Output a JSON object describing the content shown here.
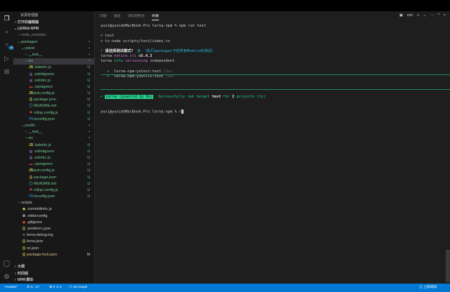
{
  "sidebar": {
    "header": "资源管理器",
    "open_editors": "打开的编辑器",
    "project": "LERNA-NPM",
    "items": [
      {
        "label": "node_modules",
        "indent": 1,
        "chev": "›",
        "icon": "",
        "status": "",
        "color": "#8c8c8c"
      },
      {
        "label": "packages",
        "indent": 1,
        "chev": "⌄",
        "icon": "",
        "status": "•",
        "color": "#73c991"
      },
      {
        "label": "yxtest",
        "indent": 2,
        "chev": "⌄",
        "icon": "",
        "status": "•",
        "color": "#73c991"
      },
      {
        "label": "__test__",
        "indent": 3,
        "chev": "›",
        "icon": "",
        "status": "•",
        "color": "#73c991"
      },
      {
        "label": "src",
        "indent": 3,
        "chev": "›",
        "icon": "",
        "status": "•",
        "color": "#73c991",
        "selected": true
      },
      {
        "label": ".babelrc.js",
        "indent": 3,
        "chev": "",
        "icon": "JS",
        "icolor": "#e8d44d",
        "status": "U",
        "color": "#73c991"
      },
      {
        "label": ".eslintignore",
        "indent": 3,
        "chev": "",
        "icon": "◎",
        "icolor": "#a074c4",
        "status": "U",
        "color": "#73c991"
      },
      {
        "label": ".eslintrc.js",
        "indent": 3,
        "chev": "",
        "icon": "◎",
        "icolor": "#a074c4",
        "status": "U",
        "color": "#73c991"
      },
      {
        "label": ".npmignore",
        "indent": 3,
        "chev": "",
        "icon": "▬",
        "icolor": "#cb3837",
        "status": "U",
        "color": "#73c991"
      },
      {
        "label": "jest.config.js",
        "indent": 3,
        "chev": "",
        "icon": "JS",
        "icolor": "#e8d44d",
        "status": "U",
        "color": "#73c991"
      },
      {
        "label": "package.json",
        "indent": 3,
        "chev": "",
        "icon": "{}",
        "icolor": "#e8d44d",
        "status": "U",
        "color": "#73c991"
      },
      {
        "label": "README.md",
        "indent": 3,
        "chev": "",
        "icon": "ⓘ",
        "icolor": "#519aba",
        "status": "U",
        "color": "#73c991"
      },
      {
        "label": "rollup.config.js",
        "indent": 3,
        "chev": "",
        "icon": "⚑",
        "icolor": "#ec4a3f",
        "status": "U",
        "color": "#73c991"
      },
      {
        "label": "tsconfig.json",
        "indent": 3,
        "chev": "",
        "icon": "TS",
        "icolor": "#3178c6",
        "status": "U",
        "color": "#73c991"
      },
      {
        "label": "yxutils",
        "indent": 2,
        "chev": "⌄",
        "icon": "",
        "status": "•",
        "color": "#73c991"
      },
      {
        "label": "__test__",
        "indent": 3,
        "chev": "›",
        "icon": "",
        "status": "•",
        "color": "#73c991"
      },
      {
        "label": "src",
        "indent": 3,
        "chev": "›",
        "icon": "",
        "status": "•",
        "color": "#73c991"
      },
      {
        "label": ".babelrc.js",
        "indent": 3,
        "chev": "",
        "icon": "JS",
        "icolor": "#e8d44d",
        "status": "U",
        "color": "#73c991"
      },
      {
        "label": ".eslintignore",
        "indent": 3,
        "chev": "",
        "icon": "◎",
        "icolor": "#a074c4",
        "status": "U",
        "color": "#73c991"
      },
      {
        "label": ".eslintrc.js",
        "indent": 3,
        "chev": "",
        "icon": "◎",
        "icolor": "#a074c4",
        "status": "U",
        "color": "#73c991"
      },
      {
        "label": ".npmignore",
        "indent": 3,
        "chev": "",
        "icon": "▬",
        "icolor": "#cb3837",
        "status": "U",
        "color": "#73c991"
      },
      {
        "label": "jest.config.js",
        "indent": 3,
        "chev": "",
        "icon": "JS",
        "icolor": "#e8d44d",
        "status": "U",
        "color": "#73c991"
      },
      {
        "label": "package.json",
        "indent": 3,
        "chev": "",
        "icon": "{}",
        "icolor": "#e8d44d",
        "status": "U",
        "color": "#73c991"
      },
      {
        "label": "README.md",
        "indent": 3,
        "chev": "",
        "icon": "ⓘ",
        "icolor": "#519aba",
        "status": "U",
        "color": "#73c991"
      },
      {
        "label": "rollup.config.js",
        "indent": 3,
        "chev": "",
        "icon": "⚑",
        "icolor": "#ec4a3f",
        "status": "U",
        "color": "#73c991"
      },
      {
        "label": "tsconfig.json",
        "indent": 3,
        "chev": "",
        "icon": "TS",
        "icolor": "#3178c6",
        "status": "U",
        "color": "#73c991"
      },
      {
        "label": "scripts",
        "indent": 1,
        "chev": "›",
        "icon": "",
        "status": "",
        "color": "#cccccc"
      },
      {
        "label": ".commitlintrc.js",
        "indent": 1,
        "chev": "",
        "icon": "◆",
        "icolor": "#e8d44d",
        "status": "",
        "color": "#cccccc"
      },
      {
        "label": ".editorconfig",
        "indent": 1,
        "chev": "",
        "icon": "⚙",
        "icolor": "#cccccc",
        "status": "",
        "color": "#cccccc"
      },
      {
        "label": ".gitignore",
        "indent": 1,
        "chev": "",
        "icon": "◆",
        "icolor": "#f14e32",
        "status": "",
        "color": "#cccccc"
      },
      {
        "label": ".prettierrc.json",
        "indent": 1,
        "chev": "",
        "icon": "{}",
        "icolor": "#e8d44d",
        "status": "",
        "color": "#cccccc"
      },
      {
        "label": "lerna-debug.log",
        "indent": 1,
        "chev": "",
        "icon": "≡",
        "icolor": "#cccccc",
        "status": "",
        "color": "#cccccc"
      },
      {
        "label": "lerna.json",
        "indent": 1,
        "chev": "",
        "icon": "{}",
        "icolor": "#e8d44d",
        "status": "",
        "color": "#cccccc"
      },
      {
        "label": "nx.json",
        "indent": 1,
        "chev": "",
        "icon": "{}",
        "icolor": "#e8d44d",
        "status": "",
        "color": "#cccccc"
      },
      {
        "label": "package-lock.json",
        "indent": 1,
        "chev": "",
        "icon": "{}",
        "icolor": "#e8d44d",
        "status": "M",
        "color": "#e2c08d"
      }
    ],
    "bottom_sections": [
      "大纲",
      "时间线",
      "NPM 脚本"
    ]
  },
  "panel": {
    "tabs": [
      "问题",
      "输出",
      "调试控制台",
      "终端"
    ],
    "active_tab": 3,
    "actions": {
      "shell_label": "zsh",
      "plus": "+",
      "split": "⌄",
      "more": "···",
      "maximize": "^",
      "close": "×"
    }
  },
  "terminal": {
    "prompt": "yuxi@yuxideMacBook-Pro lerna-npm % npm run test",
    "cmd1": "> test",
    "cmd2": "> ts-node scripts/test/index.ts",
    "q_mark": "?",
    "q_text": " 请选择测试模式？",
    "q_answer": " 全 （执行packages下的所有Module的测试）",
    "lerna_notice": "lerna ",
    "notice_word": "notice",
    "cli_word": " cli ",
    "cli_version": "v5.4.3",
    "info_prefix": "lerna ",
    "info_word": "info",
    "versioning": " versioning ",
    "independent": "independent",
    "pkg1_check": "✔",
    "pkg1": "  lerna-npm-yxtest:test ",
    "pkg1_time": "(1s)",
    "pkg2_check": "✔",
    "pkg2": "  lerna-npm-yxutils:test ",
    "pkg2_time": "(1s)",
    "summary_check": "✔",
    "summary_badge": "Lerna (powered by Nx)",
    "summary_text": "Successfully ran target ",
    "summary_target": "test",
    "summary_for": " for ",
    "summary_count": "2",
    "summary_projects": " projects (1s)",
    "final_prompt": "yuxi@yuxideMacBook-Pro lerna-npm % r"
  },
  "statusbar": {
    "branch": "master*",
    "sync": "⊘ 4↓ 17↑",
    "errors": "⊗ 0 ⚠ 0",
    "graph": "⚇ Git Graph",
    "right": "⚠ 上线调试"
  },
  "colors": {
    "accent": "#0078d4",
    "git_untracked": "#73c991",
    "git_modified": "#e2c08d",
    "terminal_green": "#23d18b"
  }
}
